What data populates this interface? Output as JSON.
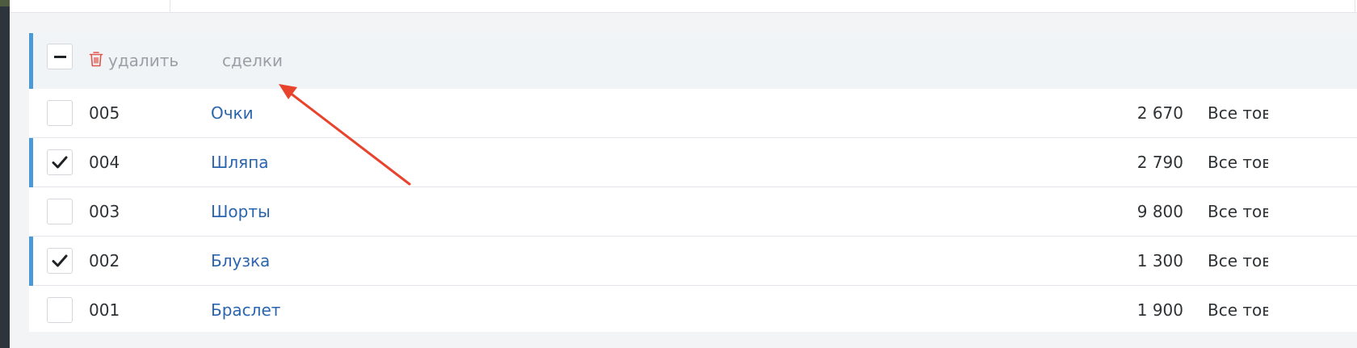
{
  "toolbar": {
    "delete_label": "удалить",
    "deals_label": "сделки"
  },
  "rows": [
    {
      "id": "005",
      "name": "Очки",
      "price": "2 670",
      "category": "Все товары",
      "checked": false
    },
    {
      "id": "004",
      "name": "Шляпа",
      "price": "2 790",
      "category": "Все товары",
      "checked": true
    },
    {
      "id": "003",
      "name": "Шорты",
      "price": "9 800",
      "category": "Все товары",
      "checked": false
    },
    {
      "id": "002",
      "name": "Блузка",
      "price": "1 300",
      "category": "Все товары",
      "checked": true
    },
    {
      "id": "001",
      "name": "Браслет",
      "price": "1 900",
      "category": "Все товары",
      "checked": false
    }
  ],
  "colors": {
    "accent": "#4a9ad8",
    "link": "#2b65ad",
    "delete_icon": "#e0554a",
    "annotation_arrow": "#e8432d"
  },
  "icons": {
    "delete": "trash-icon",
    "select_all": "minus-icon",
    "row_check": "checkmark-icon"
  }
}
